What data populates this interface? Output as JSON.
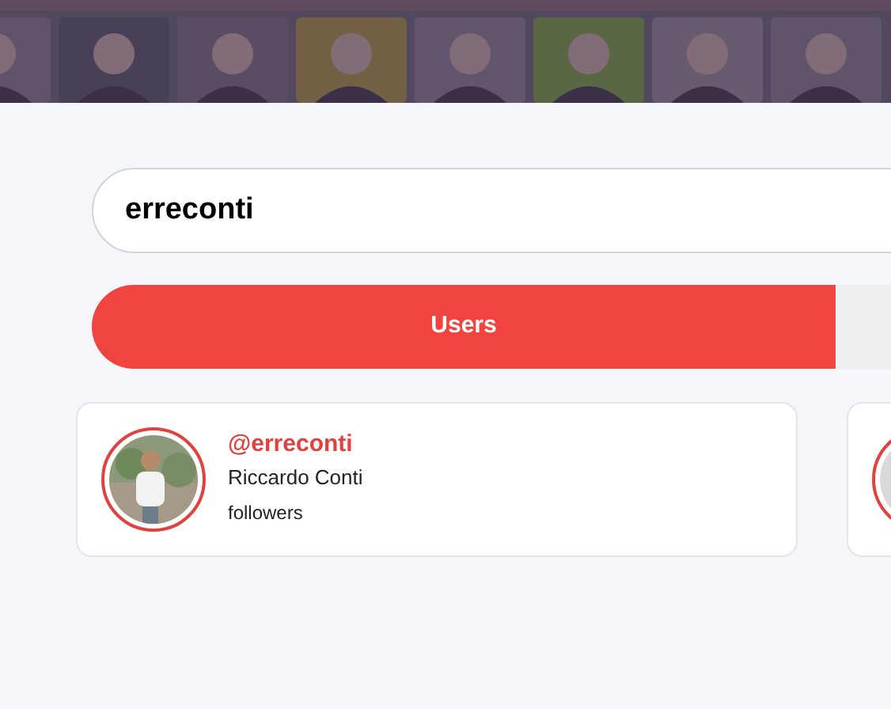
{
  "search": {
    "value": "erreconti"
  },
  "tabs": [
    {
      "label": "Users",
      "selected": true
    },
    {
      "selected": false
    }
  ],
  "users": [
    {
      "handle": "@erreconti",
      "name": "Riccardo Conti",
      "followers": "followers"
    },
    {
      "avatar": {
        "kind": "placeholder"
      }
    }
  ]
}
